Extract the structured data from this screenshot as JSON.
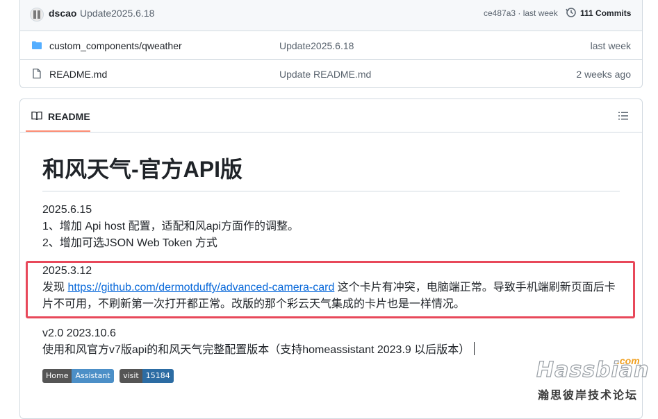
{
  "latest_commit": {
    "author": "dscao",
    "message": "Update2025.6.18",
    "hash_time": "ce487a3 · last week",
    "commits": "111 Commits"
  },
  "files": [
    {
      "name": "custom_components/qweather",
      "type": "folder",
      "message": "Update2025.6.18",
      "time": "last week"
    },
    {
      "name": "README.md",
      "type": "file",
      "message": "Update README.md",
      "time": "2 weeks ago"
    }
  ],
  "readme": {
    "tab_label": "README",
    "title": "和风天气-官方API版",
    "block1": [
      "2025.6.15",
      "1、增加 Api host 配置，适配和风api方面作的调整。",
      "2、增加可选JSON Web Token 方式"
    ],
    "block2": {
      "date": "2025.3.12",
      "prefix": "发现 ",
      "link": "https://github.com/dermotduffy/advanced-camera-card",
      "suffix": " 这个卡片有冲突，电脑端正常。导致手机端刷新页面后卡片不可用，不刷新第一次打开都正常。改版的那个彩云天气集成的卡片也是一样情况。"
    },
    "block3": [
      "v2.0 2023.10.6",
      "使用和风官方v7版api的和风天气完整配置版本（支持homeassistant 2023.9 以后版本）"
    ],
    "badges": [
      {
        "left": "Home",
        "right": "Assistant"
      },
      {
        "left": "visit",
        "right": "15184"
      }
    ]
  },
  "watermark": {
    "brand": "Hassbian",
    "com": ".com",
    "sub": "瀚思彼岸技术论坛"
  },
  "colors": {
    "highlight": "#e8485a",
    "link": "#0969da",
    "tab_underline": "#fd8c73"
  }
}
